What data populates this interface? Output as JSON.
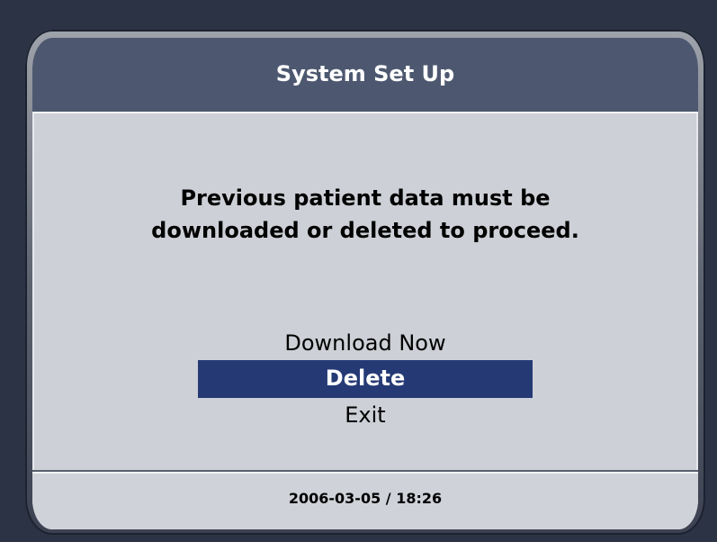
{
  "header": {
    "title": "System Set Up"
  },
  "dialog": {
    "message_line1": "Previous patient data must be",
    "message_line2": "downloaded or deleted to proceed."
  },
  "menu": {
    "items": [
      {
        "label": "Download Now",
        "selected": false
      },
      {
        "label": "Delete",
        "selected": true
      },
      {
        "label": "Exit",
        "selected": false
      }
    ]
  },
  "footer": {
    "datetime": "2006-03-05 / 18:26"
  },
  "colors": {
    "title_bar": "#4d5870",
    "selection": "#253a75",
    "screen_bg": "#cdd0d6",
    "bezel": "#2b3344"
  }
}
